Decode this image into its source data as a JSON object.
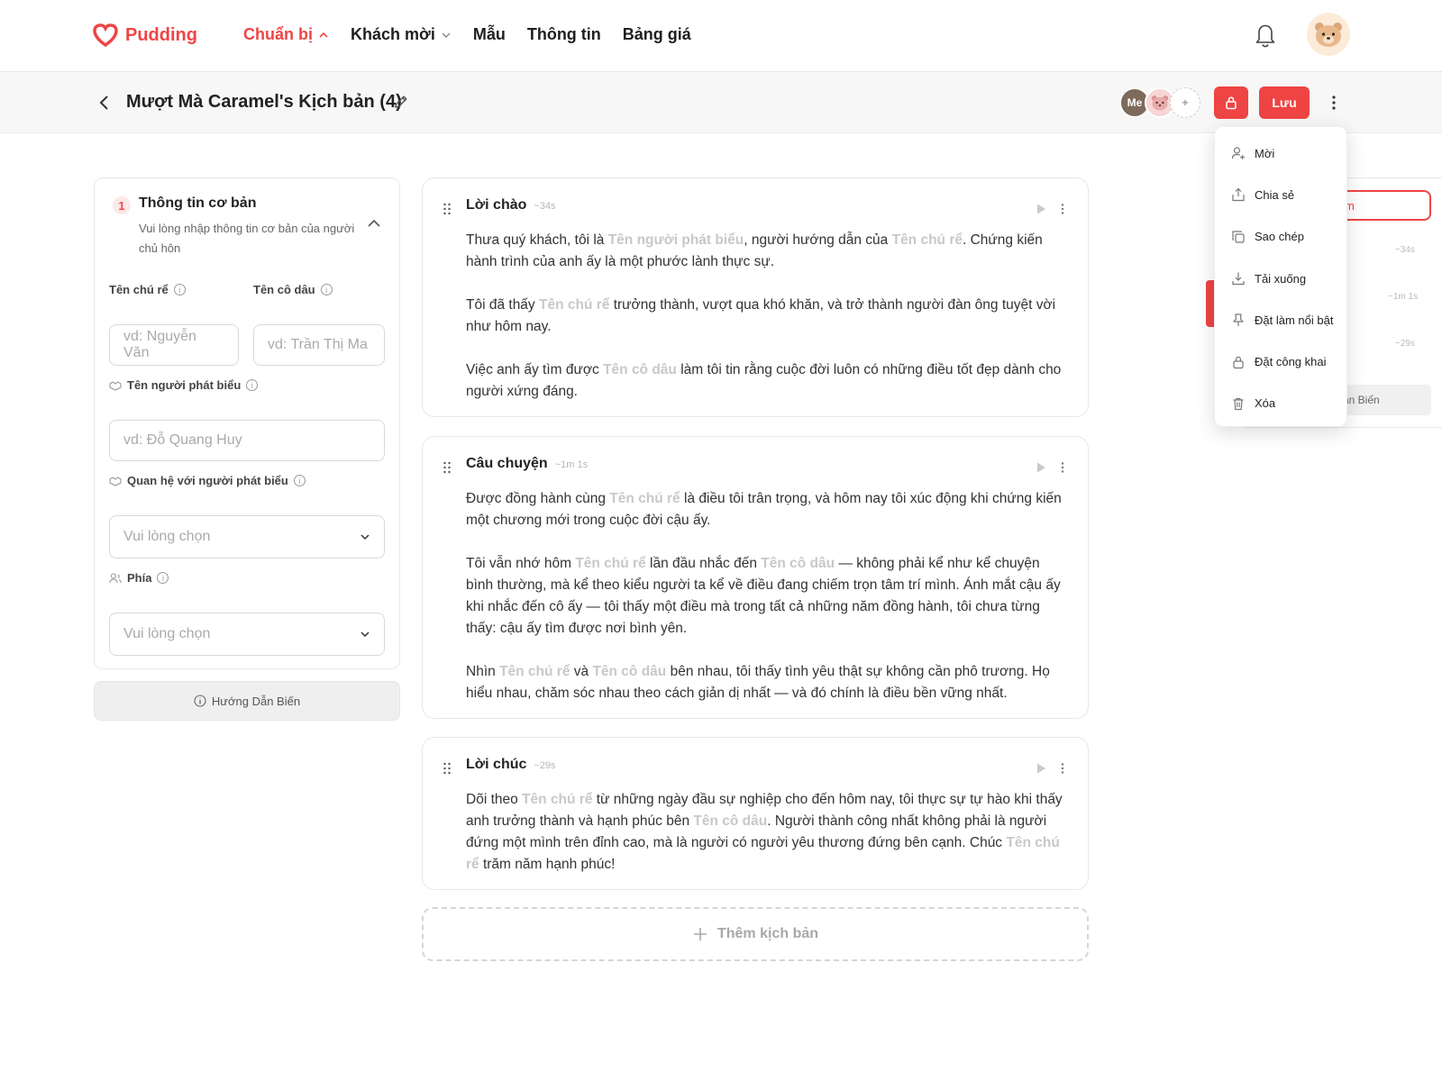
{
  "brand": {
    "name": "Pudding",
    "accent": "#ef4444"
  },
  "nav": [
    {
      "label": "Chuẩn bị",
      "active": true,
      "has_dropdown": true
    },
    {
      "label": "Khách mời",
      "active": false,
      "has_dropdown": true
    },
    {
      "label": "Mẫu",
      "active": false,
      "has_dropdown": false
    },
    {
      "label": "Thông tin",
      "active": false,
      "has_dropdown": false
    },
    {
      "label": "Bảng giá",
      "active": false,
      "has_dropdown": false
    }
  ],
  "header": {
    "title": "Mượt Mà Caramel's Kịch bản (4)",
    "collaborator_me": "Me",
    "save_label": "Lưu"
  },
  "left_panel": {
    "step": "1",
    "title": "Thông tin cơ bản",
    "description": "Vui lòng nhập thông tin cơ bản của người chủ hôn",
    "groom_label": "Tên chú rể",
    "groom_placeholder": "vd: Nguyễn Văn",
    "bride_label": "Tên cô dâu",
    "bride_placeholder": "vd: Trần Thị Ma",
    "speaker_label": "Tên người phát biểu",
    "speaker_placeholder": "vd: Đỗ Quang Huy",
    "relation_label": "Quan hệ với người phát biểu",
    "relation_value": "Vui lòng chọn",
    "side_label": "Phía",
    "side_value": "Vui lòng chọn",
    "guide_label": "Hướng Dẫn Biến"
  },
  "scripts": [
    {
      "title": "Lời chào",
      "duration": "~34s",
      "paragraphs": [
        [
          "Thưa quý khách, tôi là ",
          {
            "ph": "Tên người phát biểu"
          },
          ", người hướng dẫn của ",
          {
            "ph": "Tên chú rể"
          },
          ". Chứng kiến hành trình của anh ấy là một phước lành thực sự."
        ],
        [
          "Tôi đã thấy ",
          {
            "ph": "Tên chú rể"
          },
          " trưởng thành, vượt qua khó khăn, và trở thành người đàn ông tuyệt vời như hôm nay."
        ],
        [
          "Việc anh ấy tìm được ",
          {
            "ph": "Tên cô dâu"
          },
          " làm tôi tin rằng cuộc đời luôn có những điều tốt đẹp dành cho người xứng đáng."
        ]
      ]
    },
    {
      "title": "Câu chuyện",
      "duration": "~1m 1s",
      "paragraphs": [
        [
          "Được đồng hành cùng ",
          {
            "ph": "Tên chú rể"
          },
          " là điều tôi trân trọng, và hôm nay tôi xúc động khi chứng kiến một chương mới trong cuộc đời cậu ấy."
        ],
        [
          "Tôi vẫn nhớ hôm ",
          {
            "ph": "Tên chú rể"
          },
          " lần đầu nhắc đến ",
          {
            "ph": "Tên cô dâu"
          },
          " — không phải kể như kể chuyện bình thường, mà kể theo kiểu người ta kể về điều đang chiếm trọn tâm trí mình. Ánh mắt cậu ấy khi nhắc đến cô ấy — tôi thấy một điều mà trong tất cả những năm đồng hành, tôi chưa từng thấy: cậu ấy tìm được nơi bình yên."
        ],
        [
          "Nhìn ",
          {
            "ph": "Tên chú rể"
          },
          " và ",
          {
            "ph": "Tên cô dâu"
          },
          " bên nhau, tôi thấy tình yêu thật sự không cần phô trương. Họ hiểu nhau, chăm sóc nhau theo cách giản dị nhất — và đó chính là điều bền vững nhất."
        ]
      ]
    },
    {
      "title": "Lời chúc",
      "duration": "~29s",
      "paragraphs": [
        [
          "Dõi theo ",
          {
            "ph": "Tên chú rể"
          },
          " từ những ngày đầu sự nghiệp cho đến hôm nay, tôi thực sự tự hào khi thấy anh trưởng thành và hạnh phúc bên ",
          {
            "ph": "Tên cô dâu"
          },
          ". Người thành công nhất không phải là người đứng một mình trên đỉnh cao, mà là người có người yêu thương đứng bên cạnh. Chúc ",
          {
            "ph": "Tên chú rể"
          },
          " trăm năm hạnh phúc!"
        ]
      ]
    }
  ],
  "add_script_label": "Thêm kịch bản",
  "background_panel": {
    "red_box_text": "m",
    "durations": [
      "~34s",
      "~1m 1s",
      "~29s"
    ],
    "guide_text": "ẫn Biến"
  },
  "menu": [
    {
      "label": "Mời",
      "icon": "user-plus-icon"
    },
    {
      "label": "Chia sẻ",
      "icon": "share-icon"
    },
    {
      "label": "Sao chép",
      "icon": "copy-icon"
    },
    {
      "label": "Tải xuống",
      "icon": "download-icon"
    },
    {
      "label": "Đặt làm nổi bật",
      "icon": "pin-icon"
    },
    {
      "label": "Đặt công khai",
      "icon": "lock-icon"
    },
    {
      "label": "Xóa",
      "icon": "trash-icon"
    }
  ]
}
